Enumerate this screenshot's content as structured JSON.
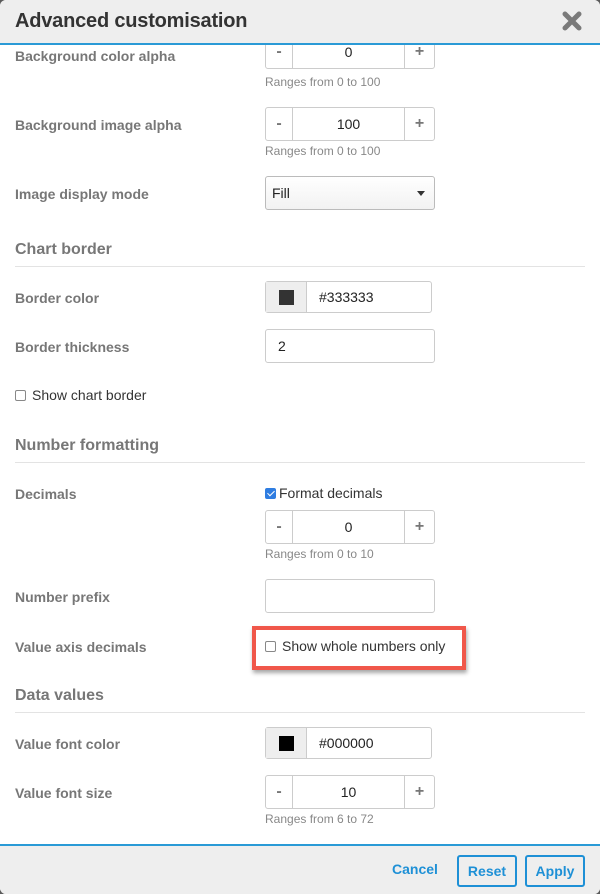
{
  "dialog": {
    "title": "Advanced customisation",
    "close_icon": "close-x-icon"
  },
  "fields": {
    "bg_color_alpha": {
      "label": "Background color alpha",
      "value": "0",
      "hint": "Ranges from 0 to 100",
      "minus": "-",
      "plus": "+"
    },
    "bg_image_alpha": {
      "label": "Background image alpha",
      "value": "100",
      "hint": "Ranges from 0 to 100",
      "minus": "-",
      "plus": "+"
    },
    "image_display_mode": {
      "label": "Image display mode",
      "selected": "Fill"
    }
  },
  "chart_border": {
    "heading": "Chart border",
    "border_color": {
      "label": "Border color",
      "value": "#333333",
      "swatch": "#333333"
    },
    "border_thickness": {
      "label": "Border thickness",
      "value": "2"
    },
    "show_chart_border": {
      "label": "Show chart border",
      "checked": false
    }
  },
  "number_formatting": {
    "heading": "Number formatting",
    "decimals": {
      "label": "Decimals",
      "format_label": "Format decimals",
      "format_checked": true,
      "value": "0",
      "hint": "Ranges from 0 to 10",
      "minus": "-",
      "plus": "+"
    },
    "number_prefix": {
      "label": "Number prefix",
      "value": ""
    },
    "value_axis_decimals": {
      "label": "Value axis decimals",
      "checkbox_label": "Show whole numbers only",
      "checked": false
    }
  },
  "data_values": {
    "heading": "Data values",
    "value_font_color": {
      "label": "Value font color",
      "value": "#000000",
      "swatch": "#000000"
    },
    "value_font_size": {
      "label": "Value font size",
      "value": "10",
      "hint": "Ranges from 6 to 72",
      "minus": "-",
      "plus": "+"
    }
  },
  "footer": {
    "cancel": "Cancel",
    "reset": "Reset",
    "apply": "Apply"
  },
  "colors": {
    "accent": "#1e90d6",
    "highlight": "#f0574a"
  }
}
